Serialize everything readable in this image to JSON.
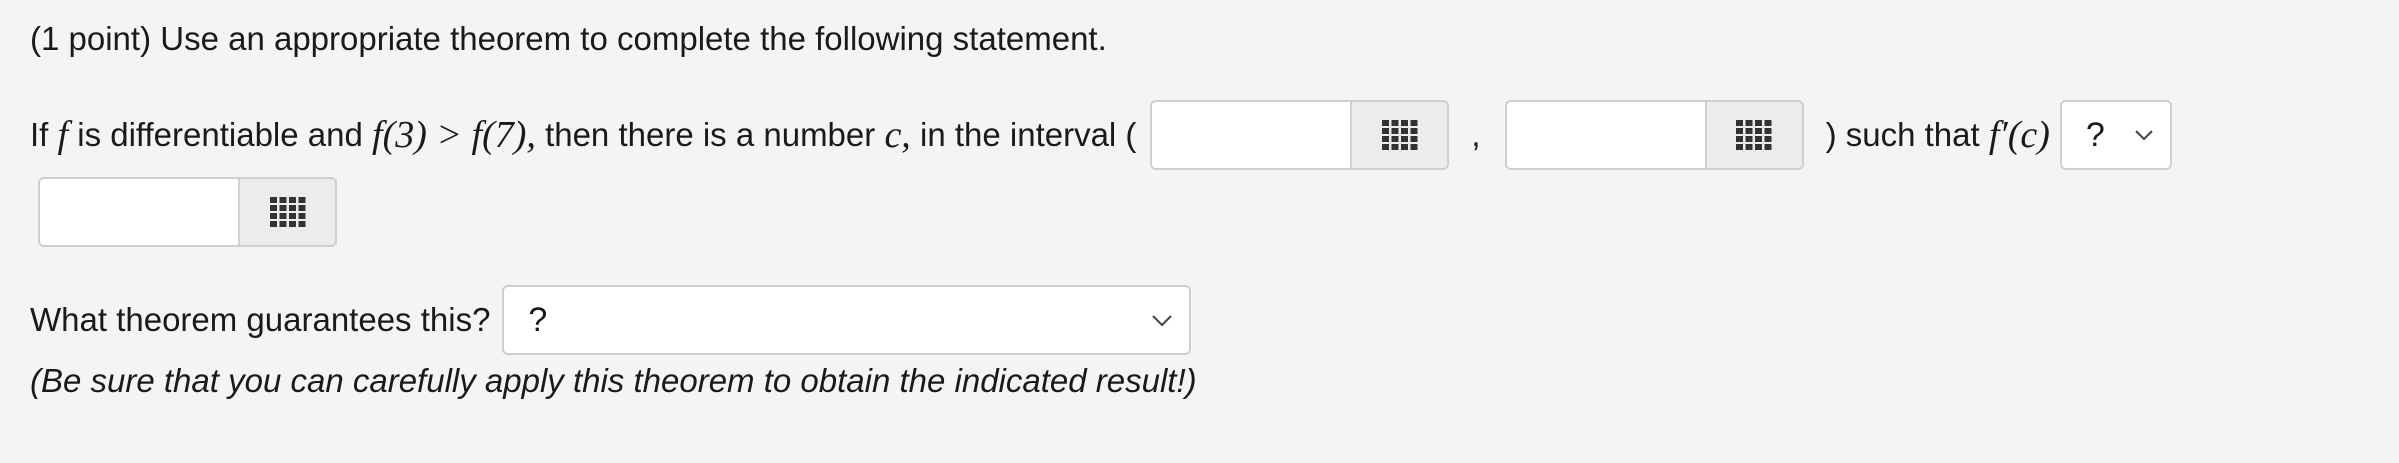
{
  "header": {
    "points": "(1 point)",
    "instruction": "Use an appropriate theorem to complete the following statement."
  },
  "statement": {
    "if_word": "If",
    "f_var": "f",
    "middle_text": "is differentiable and",
    "condition": "f(3) > f(7),",
    "then_text": "then there is a number",
    "c_var": "c,",
    "interval_text": "in the interval (",
    "comma": ",",
    "such_that": ") such that",
    "derivative": "f′(c)",
    "relation_select_value": "?"
  },
  "inputs": {
    "interval_start_value": "",
    "interval_end_value": "",
    "derivative_value": ""
  },
  "theorem": {
    "question": "What theorem guarantees this?",
    "select_value": "?"
  },
  "note": "(Be sure that you can carefully apply this theorem to obtain the indicated result!)",
  "icons": {
    "grid": "grid-icon",
    "chevron": "chevron-down-icon"
  },
  "colors": {
    "background": "#f4f4f4",
    "border": "#cfcfcf",
    "grid_button": "#ececec"
  }
}
